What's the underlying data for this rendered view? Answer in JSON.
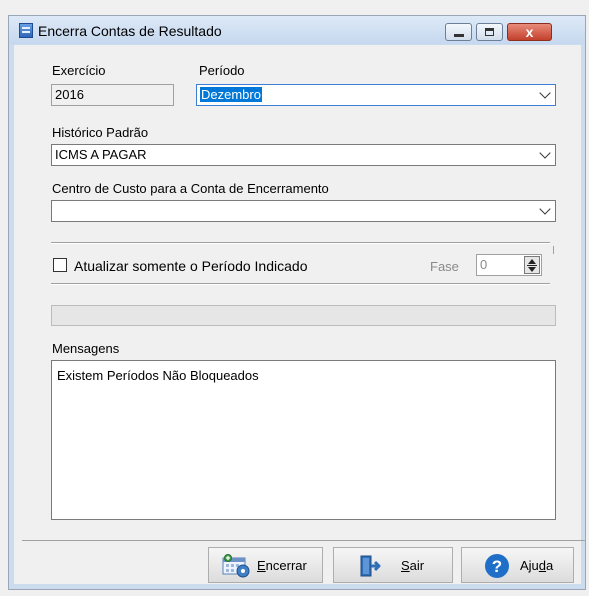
{
  "window": {
    "title": "Encerra Contas de Resultado",
    "close_glyph": "x"
  },
  "form": {
    "exercicio_label": "Exercício",
    "exercicio_value": "2016",
    "periodo_label": "Período",
    "periodo_value": "Dezembro",
    "historico_label": "Histórico Padrão",
    "historico_value": "ICMS A PAGAR",
    "centro_label": "Centro de Custo para a Conta de Encerramento",
    "centro_value": "",
    "atualizar_label": "Atualizar somente o Período Indicado",
    "atualizar_checked": false,
    "fase_label": "Fase",
    "fase_value": "0",
    "progress_fraction": 0,
    "mensagens_label": "Mensagens",
    "mensagens_text": "Existem Períodos Não Bloqueados"
  },
  "buttons": {
    "encerrar_mnemonic": "E",
    "encerrar_rest": "ncerrar",
    "sair_mnemonic": "S",
    "sair_rest": "air",
    "ajuda_pre": "Aju",
    "ajuda_mnemonic": "d",
    "ajuda_post": "a"
  },
  "colors": {
    "titlebar": "#c6d8ef",
    "selection": "#0078d7",
    "help_icon": "#1f6fc9"
  }
}
